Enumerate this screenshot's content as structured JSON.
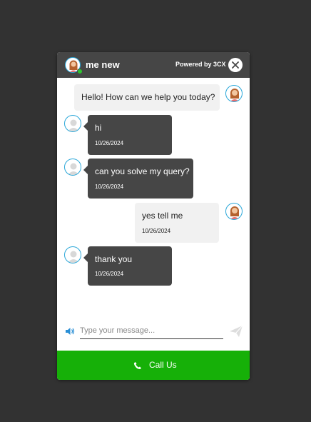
{
  "header": {
    "agent_name": "me new",
    "powered_by": "Powered by 3CX",
    "status_color": "#2ec62e"
  },
  "messages": [
    {
      "from": "agent",
      "text": "Hello! How can we help you today?",
      "time": ""
    },
    {
      "from": "visitor",
      "text": "hi",
      "time": "10/26/2024"
    },
    {
      "from": "visitor",
      "text": "can you solve my query?",
      "time": "10/26/2024"
    },
    {
      "from": "agent",
      "text": "yes tell me",
      "time": "10/26/2024"
    },
    {
      "from": "visitor",
      "text": "thank you",
      "time": "10/26/2024"
    }
  ],
  "composer": {
    "placeholder": "Type your message...",
    "value": ""
  },
  "call_button": {
    "label": "Call Us",
    "color": "#16b008"
  },
  "colors": {
    "header_bg": "#464646",
    "visitor_bubble": "#464646",
    "agent_bubble": "#f1f1f1",
    "page_bg": "#323232",
    "avatar_ring": "#2aa7d9"
  }
}
